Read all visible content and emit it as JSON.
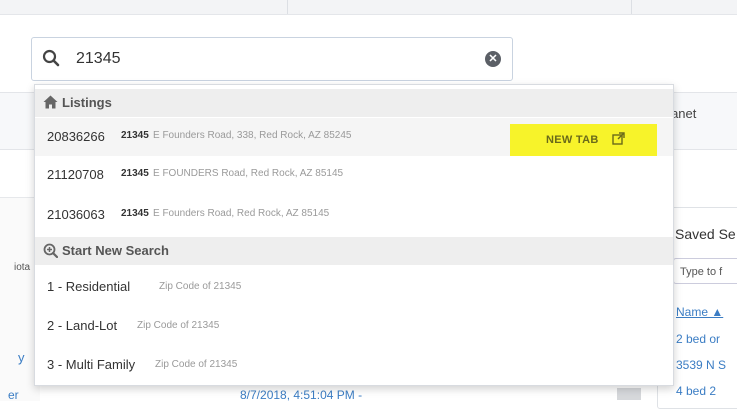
{
  "search": {
    "value": "21345",
    "placeholder": ""
  },
  "dropdown": {
    "listings_header": "Listings",
    "listings": [
      {
        "mls": "20836266",
        "zip": "21345",
        "address": "E Founders Road, 338, Red Rock, AZ 85245"
      },
      {
        "mls": "21120708",
        "zip": "21345",
        "address": "E FOUNDERS Road, Red Rock, AZ 85145"
      },
      {
        "mls": "21036063",
        "zip": "21345",
        "address": "E Founders Road, Red Rock, AZ 85145"
      }
    ],
    "new_tab_label": "NEW TAB",
    "new_search_header": "Start New Search",
    "searches": [
      {
        "label": "1 - Residential",
        "detail": "Zip Code of 21345"
      },
      {
        "label": "2 - Land-Lot",
        "detail": "Zip Code of 21345"
      },
      {
        "label": "3 - Multi Family",
        "detail": "Zip Code of 21345"
      }
    ]
  },
  "background": {
    "nav_intranet": "S Intranet",
    "left_nota": "iota",
    "left_y": "y",
    "left_er": "er",
    "bottom_date": "8/7/2018, 4:51:04 PM  -",
    "saved_title": "Saved Se",
    "saved_filter_placeholder": "Type to f",
    "saved_name_header": "Name ▲",
    "saved_rows": [
      "2 bed or",
      "3539 N S",
      "4 bed 2"
    ]
  },
  "colors": {
    "highlight": "#f7f32a",
    "link": "#3b7dc4",
    "section_bg": "#eeeeee"
  },
  "icons": {
    "search": "search-icon",
    "clear": "clear-icon",
    "home": "home-icon",
    "new_search": "search-plus-icon",
    "external": "external-link-icon"
  }
}
